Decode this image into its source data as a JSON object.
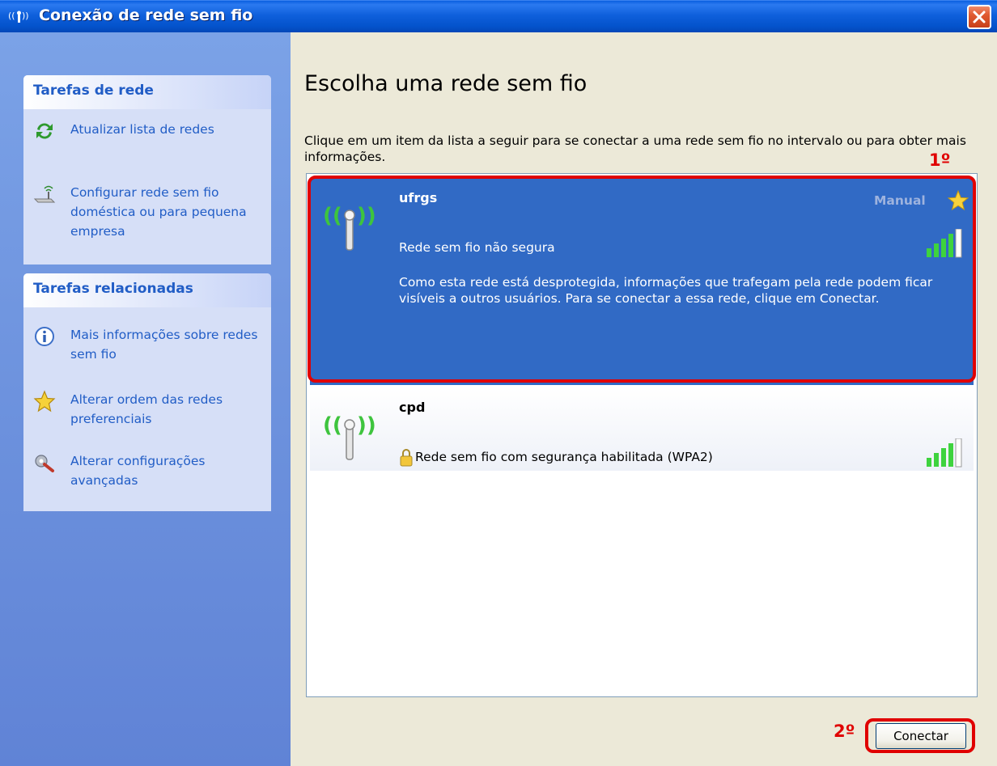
{
  "window": {
    "title": "Conexão de rede sem fio"
  },
  "sidebar": {
    "sections": [
      {
        "title": "Tarefas de rede",
        "items": [
          {
            "label": "Atualizar lista de redes",
            "icon": "refresh-icon"
          },
          {
            "label": "Configurar rede sem fio doméstica ou para pequena empresa",
            "icon": "wireless-setup-icon"
          }
        ]
      },
      {
        "title": "Tarefas relacionadas",
        "items": [
          {
            "label": "Mais informações sobre redes sem fio",
            "icon": "info-icon"
          },
          {
            "label": "Alterar ordem das redes preferenciais",
            "icon": "star-icon"
          },
          {
            "label": "Alterar configurações avançadas",
            "icon": "settings-icon"
          }
        ]
      }
    ]
  },
  "main": {
    "title": "Escolha uma rede sem fio",
    "description": "Clique em um item da lista a seguir para se conectar a uma rede sem fio no intervalo ou para obter mais informações.",
    "networks": [
      {
        "name": "ufrgs",
        "tag": "Manual",
        "status": "Rede sem fio não segura",
        "description": "Como esta rede está desprotegida, informações que trafegam pela rede podem ficar visíveis a outros usuários. Para se conectar a essa rede, clique em Conectar.",
        "selected": true,
        "secured": false
      },
      {
        "name": "cpd",
        "status": "Rede sem fio com segurança habilitada (WPA2)",
        "selected": false,
        "secured": true
      }
    ],
    "connect_label": "Conectar"
  },
  "annotations": {
    "step1": "1º",
    "step2": "2º",
    "color": "#E00000"
  },
  "colors": {
    "selection": "#316AC5",
    "sidebar_link": "#215DC6",
    "titlebar": "#0453CC"
  }
}
